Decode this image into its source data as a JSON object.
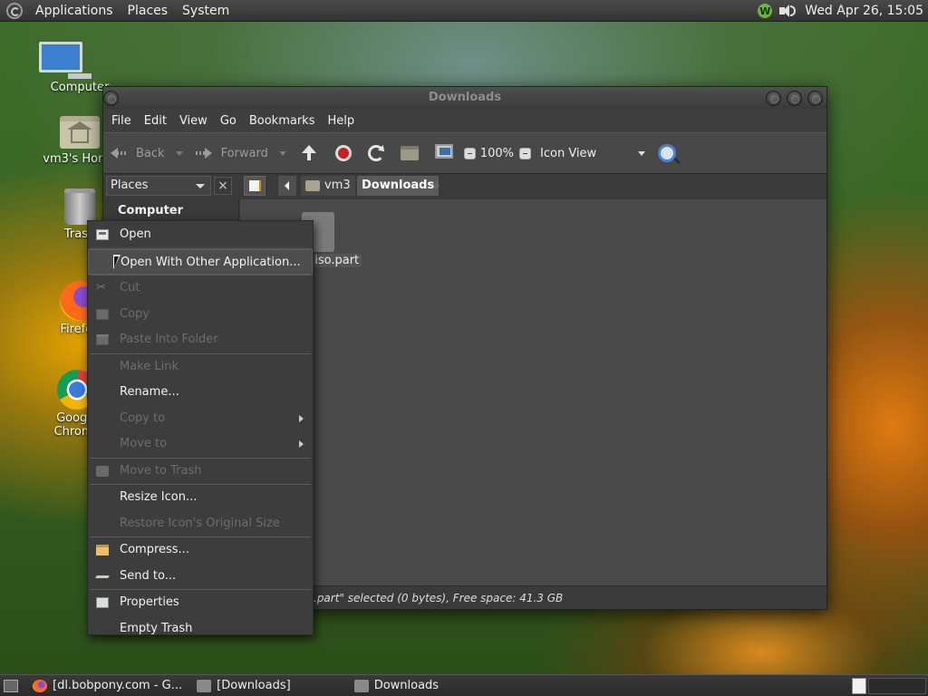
{
  "top_panel": {
    "menus": [
      "Applications",
      "Places",
      "System"
    ],
    "clock": "Wed Apr 26, 15:05",
    "tray_badge": "W"
  },
  "desktop": {
    "icons": [
      {
        "label": "Computer",
        "icon": "computer-icon"
      },
      {
        "label": "vm3's Home",
        "icon": "home-folder-icon"
      },
      {
        "label": "Trash",
        "icon": "trash-icon"
      },
      {
        "label": "Firefox",
        "icon": "firefox-icon"
      },
      {
        "label": "Google Chrome",
        "icon": "chrome-icon"
      }
    ]
  },
  "window": {
    "title": "Downloads",
    "menubar": [
      "File",
      "Edit",
      "View",
      "Go",
      "Bookmarks",
      "Help"
    ],
    "toolbar": {
      "back": "Back",
      "forward": "Forward",
      "zoom": "100%",
      "view_mode": "Icon View"
    },
    "sidebar": {
      "selector": "Places",
      "close": "×",
      "heading": "Computer"
    },
    "path": {
      "crumbs": [
        "vm3",
        "Downloads"
      ]
    },
    "file": {
      "name": "t.iso.part"
    },
    "status": ".part\" selected (0 bytes), Free space: 41.3 GB"
  },
  "context_menu": {
    "items": [
      {
        "label": "Open",
        "enabled": true,
        "icon": "open-icon"
      },
      {
        "label": "Open With Other Application...",
        "enabled": true,
        "highlighted": true
      },
      {
        "label": "Cut",
        "enabled": false,
        "icon": "scissors-icon"
      },
      {
        "label": "Copy",
        "enabled": false,
        "icon": "copy-icon"
      },
      {
        "label": "Paste Into Folder",
        "enabled": false,
        "icon": "paste-icon"
      },
      {
        "label": "Make Link",
        "enabled": false
      },
      {
        "label": "Rename...",
        "enabled": true
      },
      {
        "label": "Copy to",
        "enabled": false,
        "submenu": true
      },
      {
        "label": "Move to",
        "enabled": false,
        "submenu": true
      },
      {
        "label": "Move to Trash",
        "enabled": false,
        "icon": "trash-icon"
      },
      {
        "label": "Resize Icon...",
        "enabled": true
      },
      {
        "label": "Restore Icon's Original Size",
        "enabled": false
      },
      {
        "label": "Compress...",
        "enabled": true,
        "icon": "compress-icon"
      },
      {
        "label": "Send to...",
        "enabled": true,
        "icon": "send-icon"
      },
      {
        "label": "Properties",
        "enabled": true,
        "icon": "properties-icon"
      },
      {
        "label": "Empty Trash",
        "enabled": true
      }
    ]
  },
  "bottom_panel": {
    "tasks": [
      "[dl.bobpony.com - G...",
      "[Downloads]",
      "Downloads"
    ]
  }
}
